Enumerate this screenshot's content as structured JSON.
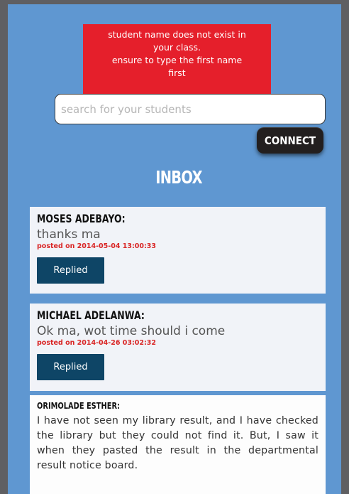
{
  "error": {
    "lines": [
      "student name does not exist in",
      "your class.",
      "ensure to type the first name",
      "first"
    ]
  },
  "search": {
    "placeholder": "search for your students",
    "value": ""
  },
  "connect_label": "CONNECT",
  "inbox_title": "INBOX",
  "messages": [
    {
      "sender": "MOSES ADEBAYO:",
      "text": "thanks ma",
      "posted": "posted on 2014-05-04 13:00:33",
      "button": "Replied"
    },
    {
      "sender": "MICHAEL ADELANWA:",
      "text": "Ok ma, wot time should i come",
      "posted": "posted on 2014-04-26 03:02:32",
      "button": "Replied"
    },
    {
      "sender": "ORIMOLADE ESTHER:",
      "text": "I have not seen my library result, and I have checked the library but they could not find it. But, I saw it when they pasted the result in the departmental result notice board."
    }
  ],
  "colors": {
    "background": "#5f97d1",
    "error": "#e51f2b",
    "button": "#0e4566",
    "connect": "#231f1f"
  }
}
